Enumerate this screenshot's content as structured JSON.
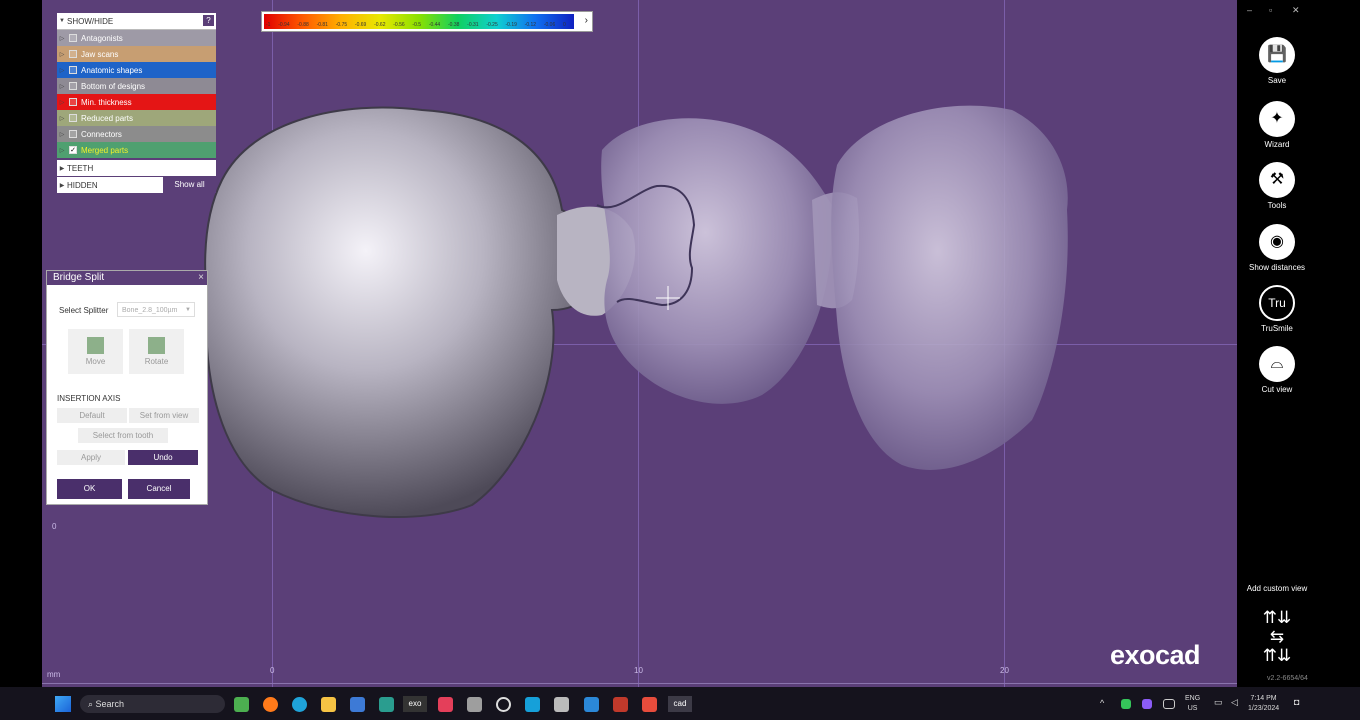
{
  "viewport": {
    "ruler_unit": "mm",
    "tick_0": "0",
    "tick_10": "10",
    "tick_20": "20",
    "left_tick": "0"
  },
  "color_scale": {
    "labels": [
      "-1",
      "-0.94",
      "-0.88",
      "-0.81",
      "-0.75",
      "-0.69",
      "-0.62",
      "-0.56",
      "-0.5",
      "-0.44",
      "-0.38",
      "-0.31",
      "-0.25",
      "-0.19",
      "-0.12",
      "-0.06",
      "0"
    ],
    "arrow": "›"
  },
  "show_hide": {
    "title": "SHOW/HIDE",
    "help": "?",
    "items": [
      {
        "label": "Antagonists",
        "color": "#9e9aa6",
        "checked": false
      },
      {
        "label": "Jaw scans",
        "color": "#c79e72",
        "checked": false
      },
      {
        "label": "Anatomic shapes",
        "color": "#1e63c8",
        "checked": false
      },
      {
        "label": "Bottom of designs",
        "color": "#8e8a94",
        "checked": false
      },
      {
        "label": "Min. thickness",
        "color": "#e41515",
        "checked": false
      },
      {
        "label": "Reduced parts",
        "color": "#9ea77a",
        "checked": false
      },
      {
        "label": "Connectors",
        "color": "#8c8c8c",
        "checked": false
      },
      {
        "label": "Merged parts",
        "color": "#4fa070",
        "checked": true
      }
    ],
    "teeth": "TEETH",
    "hidden": "HIDDEN",
    "show_all": "Show all"
  },
  "dialog": {
    "title": "Bridge Split",
    "close": "×",
    "select_splitter_label": "Select Splitter",
    "splitter_value": "Bone_2.8_100µm",
    "move": "Move",
    "rotate": "Rotate",
    "insertion_axis": "INSERTION AXIS",
    "default": "Default",
    "set_from_view": "Set from view",
    "select_from_tooth": "Select from tooth",
    "apply": "Apply",
    "undo": "Undo",
    "ok": "OK",
    "cancel": "Cancel"
  },
  "toolbar": {
    "save": "Save",
    "wizard": "Wizard",
    "tools": "Tools",
    "show_distances": "Show distances",
    "trusmile": "TruSmile",
    "trusmile_icon_text": "Tru",
    "cut_view": "Cut view",
    "add_custom_view": "Add custom view",
    "version": "v2.2-6654/64"
  },
  "brand": "exocad",
  "taskbar": {
    "search": "Search",
    "exo": "exo",
    "cad": "cad",
    "lang_top": "ENG",
    "lang_bottom": "US",
    "time": "7:14 PM",
    "date": "1/23/2024"
  }
}
